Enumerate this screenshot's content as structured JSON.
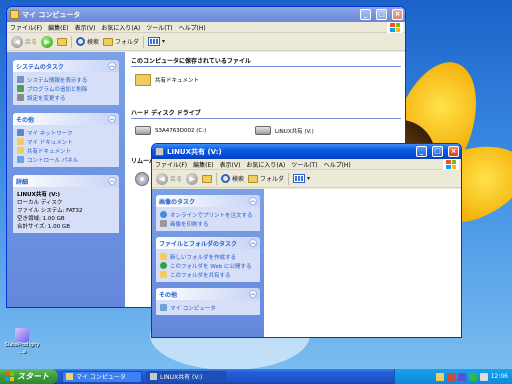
{
  "desktop": {
    "icon_label": "SlateProdigity",
    "icon_label_line2": "...a"
  },
  "window1": {
    "title": "マイ コンピュータ",
    "menu": [
      "ファイル(F)",
      "編集(E)",
      "表示(V)",
      "お気に入り(A)",
      "ツール(T)",
      "ヘルプ(H)"
    ],
    "toolbar": {
      "back_label": "戻る",
      "search_label": "検索",
      "folders_label": "フォルダ"
    },
    "sidebar": {
      "system_tasks": {
        "title": "システムのタスク",
        "items": [
          "システム情報を表示する",
          "プログラムの追加と削除",
          "設定を変更する"
        ]
      },
      "other_places": {
        "title": "その他",
        "items": [
          "マイ ネットワーク",
          "マイ ドキュメント",
          "共有ドキュメント",
          "コントロール パネル"
        ]
      },
      "details": {
        "title": "詳細",
        "name": "LINUX共有 (V:)",
        "type": "ローカル ディスク",
        "fs": "ファイル システム: FAT32",
        "free": "空き領域: 1.00 GB",
        "total": "合計サイズ: 1.00 GB"
      }
    },
    "content": {
      "stored_files_header": "このコンピュータに保存されているファイル",
      "shared_docs": "共有ドキュメント",
      "hdd_header": "ハード ディスク ドライブ",
      "drive_c": "S3A4763D002 (C:)",
      "drive_v": "LINUX共有 (V:)",
      "removable_header": "リムーバ"
    }
  },
  "window2": {
    "title": "LINUX共有 (V:)",
    "menu": [
      "ファイル(F)",
      "編集(E)",
      "表示(V)",
      "お気に入り(A)",
      "ツール(T)",
      "ヘルプ(H)"
    ],
    "toolbar": {
      "back_label": "戻る",
      "search_label": "検索",
      "folders_label": "フォルダ"
    },
    "sidebar": {
      "printing": {
        "title": "画像のタスク",
        "items": [
          "オンラインでプリントを注文する",
          "画像を印刷する"
        ]
      },
      "file_tasks": {
        "title": "ファイルとフォルダのタスク",
        "items": [
          "新しいフォルダを作成する",
          "このフォルダを Web に公開する",
          "このフォルダを共有する"
        ]
      },
      "other_places": {
        "title": "その他",
        "items": [
          "マイ コンピュータ"
        ]
      }
    }
  },
  "taskbar": {
    "start_label": "スタート",
    "tasks": [
      "マイ コンピュータ",
      "LINUX共有 (V:)"
    ],
    "clock": "12:06"
  },
  "colors": {
    "title_active": "#0a5ae0",
    "title_inactive": "#7a96df",
    "sidebar_blue": "#6487dc",
    "link_blue": "#215dc6",
    "taskbar": "#245edb",
    "start_green": "#3a9b3a"
  }
}
